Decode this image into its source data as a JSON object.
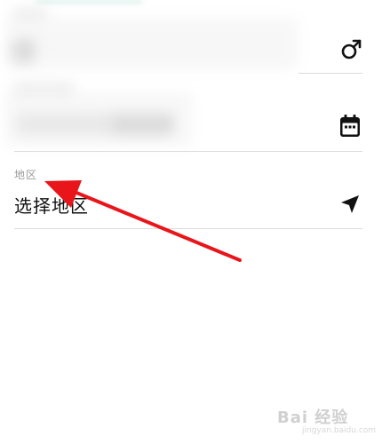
{
  "form": {
    "region": {
      "label": "地区",
      "placeholder_value": "选择地区"
    }
  },
  "icons": {
    "gender": "male-icon",
    "birthday": "calendar-icon",
    "region": "location-arrow-icon"
  },
  "colors": {
    "annotation_arrow": "#e8161b",
    "divider": "#dcdcdc",
    "label": "#9a9a9a",
    "text": "#111111"
  },
  "watermark": {
    "brand": "Bai 经验",
    "sub": "jingyan.baidu.com"
  }
}
